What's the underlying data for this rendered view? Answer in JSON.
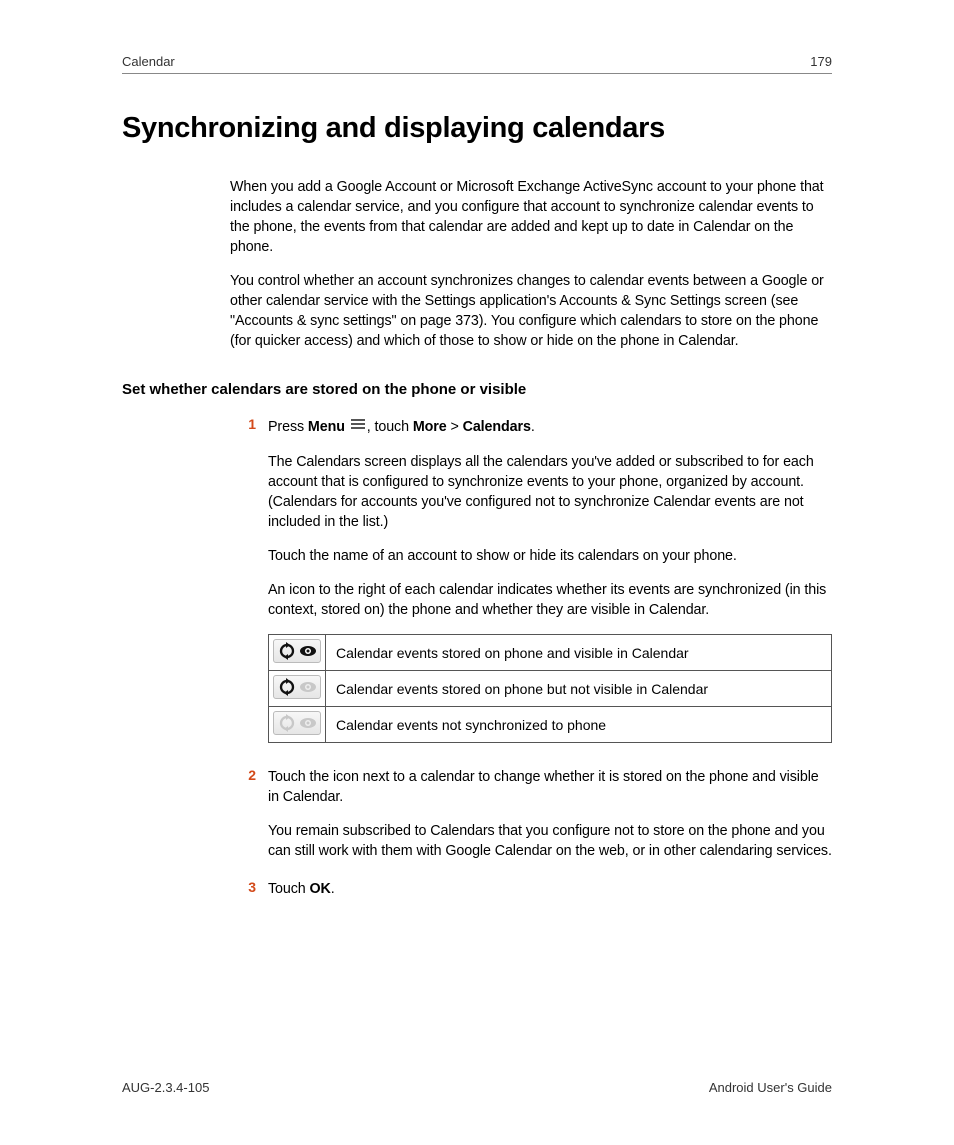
{
  "header": {
    "section": "Calendar",
    "page_number": "179"
  },
  "title": "Synchronizing and displaying calendars",
  "intro": {
    "p1": "When you add a Google Account or Microsoft Exchange ActiveSync account to your phone that includes a calendar service, and you configure that account to synchronize calendar events to the phone, the events from that calendar are added and kept up to date in Calendar on the phone.",
    "p2": "You control whether an account synchronizes changes to calendar events between a Google or other calendar service with the Settings application's Accounts & Sync Settings screen (see \"Accounts & sync settings\" on page 373). You configure which calendars to store on the phone (for quicker access) and which of those to show or hide on the phone in Calendar."
  },
  "subhead": "Set whether calendars are stored on the phone or visible",
  "step1": {
    "num": "1",
    "line_a": "Press ",
    "menu_bold": "Menu",
    "line_b": ", touch ",
    "more_bold": "More",
    "sep": " > ",
    "cal_bold": "Calendars",
    "line_c": ".",
    "p2": "The Calendars screen displays all the calendars you've added or subscribed to for each account that is configured to synchronize events to your phone, organized by account. (Calendars for accounts you've configured not to synchronize Calendar events are not included in the list.)",
    "p3": "Touch the name of an account to show or hide its calendars on your phone.",
    "p4": "An icon to the right of each calendar indicates whether its events are synchronized (in this context, stored on) the phone and whether they are visible in Calendar."
  },
  "table": {
    "row1": "Calendar events stored on phone and visible in Calendar",
    "row2": "Calendar events stored on phone but not visible in Calendar",
    "row3": "Calendar events not synchronized to phone"
  },
  "step2": {
    "num": "2",
    "p1": "Touch the icon next to a calendar to change whether it is stored on the phone and visible in Calendar.",
    "p2": "You remain subscribed to Calendars that you configure not to store on the phone and you can still work with them with Google Calendar on the web, or in other calendaring services."
  },
  "step3": {
    "num": "3",
    "prefix": "Touch ",
    "ok_bold": "OK",
    "suffix": "."
  },
  "footer": {
    "left": "AUG-2.3.4-105",
    "right": "Android User's Guide"
  }
}
